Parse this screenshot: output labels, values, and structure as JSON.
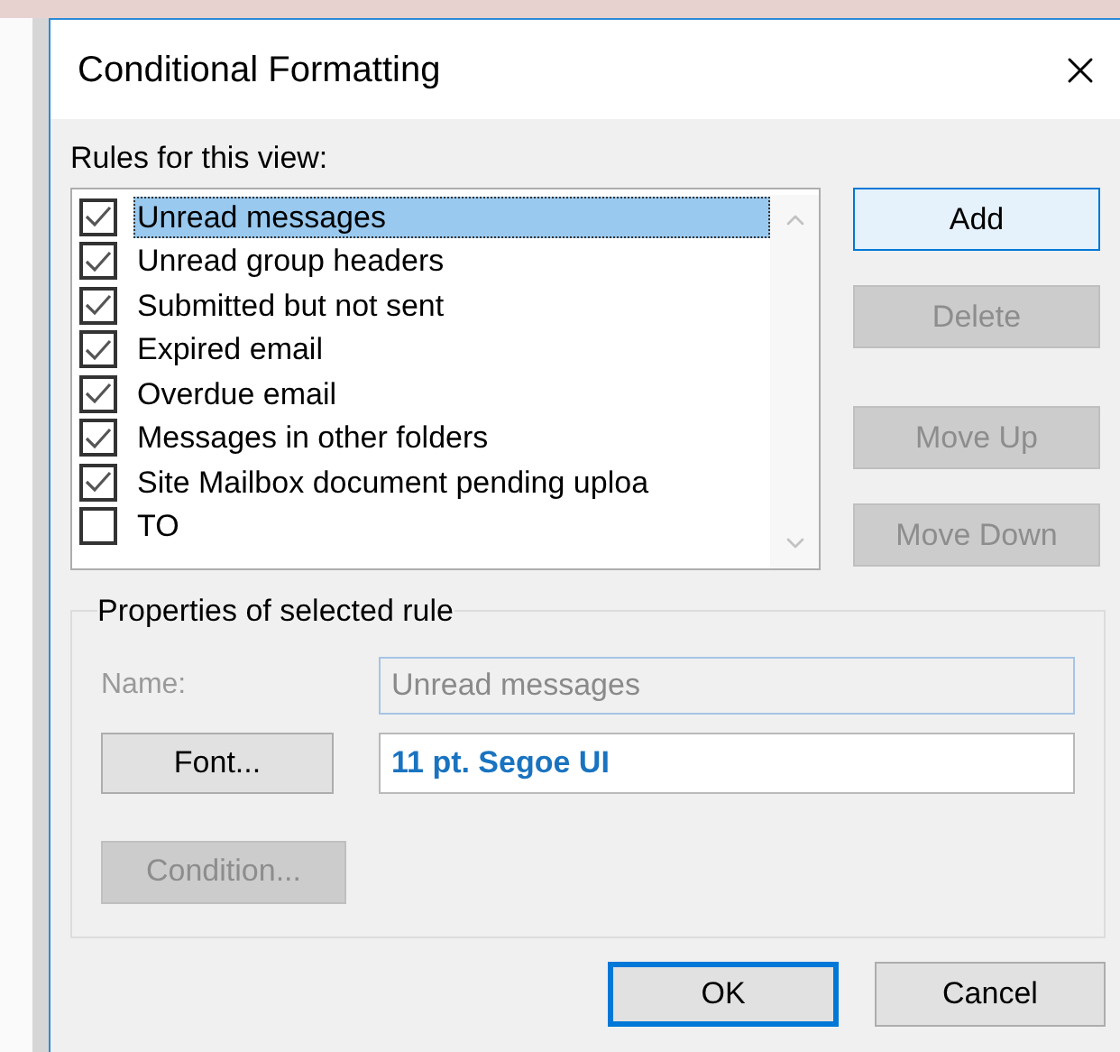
{
  "window": {
    "title": "Conditional Formatting"
  },
  "rules_label": "Rules for this view:",
  "rules": [
    {
      "label": "Unread messages",
      "checked": true,
      "selected": true
    },
    {
      "label": "Unread group headers",
      "checked": true,
      "selected": false
    },
    {
      "label": "Submitted but not sent",
      "checked": true,
      "selected": false
    },
    {
      "label": "Expired email",
      "checked": true,
      "selected": false
    },
    {
      "label": "Overdue email",
      "checked": true,
      "selected": false
    },
    {
      "label": "Messages in other folders",
      "checked": true,
      "selected": false
    },
    {
      "label": "Site Mailbox document pending uploa",
      "checked": true,
      "selected": false
    },
    {
      "label": "TO",
      "checked": false,
      "selected": false
    }
  ],
  "side_buttons": [
    {
      "label": "Add",
      "disabled": false,
      "focused": true
    },
    {
      "label": "Delete",
      "disabled": true,
      "focused": false
    },
    {
      "label": "Move Up",
      "disabled": true,
      "focused": false
    },
    {
      "label": "Move Down",
      "disabled": true,
      "focused": false
    }
  ],
  "properties": {
    "legend": "Properties of selected rule",
    "name": {
      "label": "Name:",
      "value": "Unread messages",
      "disabled": true
    },
    "font_button": {
      "label": "Font...",
      "disabled": false
    },
    "font_value": "11 pt. Segoe UI",
    "condition_button": {
      "label": "Condition...",
      "disabled": true
    }
  },
  "buttons": [
    {
      "label": "OK",
      "default": true
    },
    {
      "label": "Cancel",
      "default": false
    }
  ]
}
